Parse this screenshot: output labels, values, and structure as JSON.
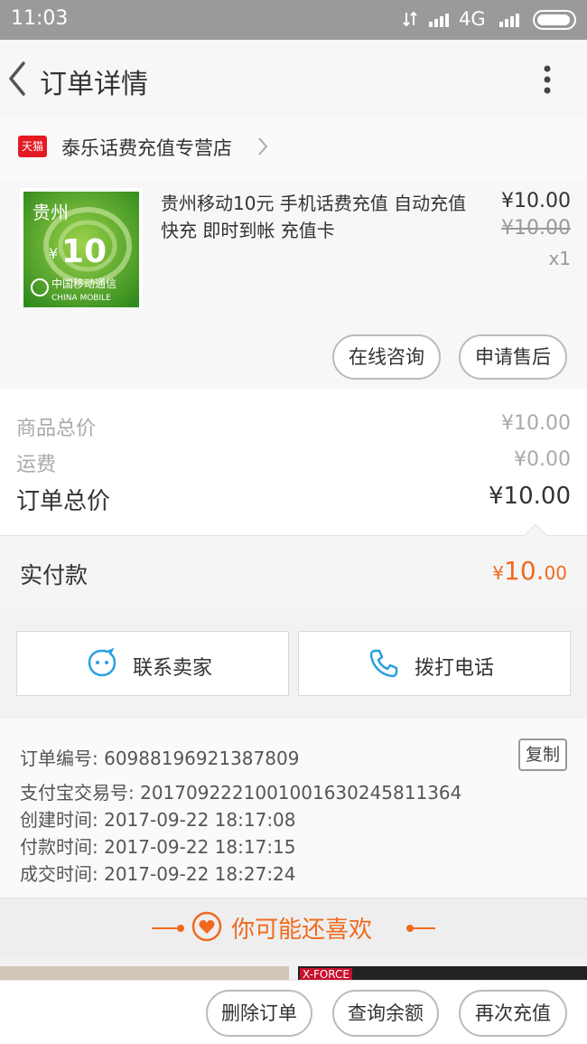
{
  "status_bar": {
    "time": "11:03",
    "network": "4G"
  },
  "nav": {
    "title": "订单详情"
  },
  "shop": {
    "badge": "天猫",
    "name": "泰乐话费充值专营店"
  },
  "product": {
    "thumb_region": "贵州",
    "thumb_amount": "10",
    "thumb_currency": "¥",
    "thumb_brand_cn": "中国移动通信",
    "thumb_brand_en": "CHINA MOBILE",
    "title": "贵州移动10元 手机话费充值 自动充值 快充 即时到帐 充值卡",
    "price": "¥10.00",
    "original_price": "¥10.00",
    "quantity": "x1",
    "consult_label": "在线咨询",
    "aftersale_label": "申请售后"
  },
  "summary": {
    "goods_total_label": "商品总价",
    "goods_total_value": "¥10.00",
    "shipping_label": "运费",
    "shipping_value": "¥0.00",
    "order_total_label": "订单总价",
    "order_total_value": "¥10.00"
  },
  "paid": {
    "label": "实付款",
    "currency": "¥",
    "integer": "10.",
    "decimal": "00"
  },
  "contact": {
    "seller_label": "联系卖家",
    "call_label": "拨打电话"
  },
  "order_info": {
    "order_no": "订单编号: 60988196921387809",
    "alipay_no": "支付宝交易号: 2017092221001001630245811364",
    "created": "创建时间: 2017-09-22 18:17:08",
    "paid": "付款时间: 2017-09-22 18:17:15",
    "completed": "成交时间: 2017-09-22 18:27:24",
    "copy_label": "复制"
  },
  "recommend": {
    "title": "你可能还喜欢",
    "banner_text": "X-FORCE"
  },
  "actions": {
    "delete_label": "删除订单",
    "balance_label": "查询余额",
    "recharge_label": "再次充值"
  },
  "colors": {
    "accent": "#f06a1e",
    "tmall_red": "#e41a22",
    "link_blue": "#2a9fe0"
  }
}
